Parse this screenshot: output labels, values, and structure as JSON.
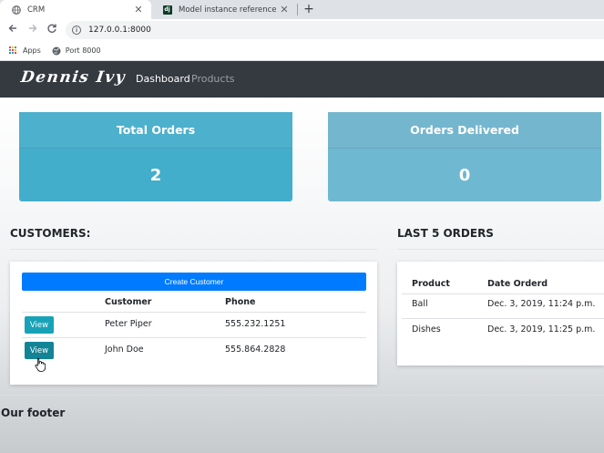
{
  "browser": {
    "tabs": [
      {
        "title": "CRM",
        "active": true
      },
      {
        "title": "Model instance reference | Djang",
        "active": false
      }
    ],
    "close_glyph": "✕",
    "new_tab_glyph": "+",
    "url": "127.0.0.1:8000",
    "bookmarks": [
      {
        "label": "Apps",
        "icon": "apps-grid-icon"
      },
      {
        "label": "Port 8000",
        "icon": "globe-icon"
      }
    ],
    "django_favicon_text": "dj"
  },
  "navbar": {
    "brand": "Dennis Ivy",
    "links": [
      {
        "label": "Dashboard",
        "active": true
      },
      {
        "label": "Products",
        "active": false
      }
    ]
  },
  "stats": {
    "total_orders": {
      "label": "Total Orders",
      "value": "2",
      "color": "#42aecb"
    },
    "orders_delivered": {
      "label": "Orders Delivered",
      "value": "0",
      "color": "#6fb8d1"
    }
  },
  "customers": {
    "title": "CUSTOMERS:",
    "create_label": "Create Customer",
    "columns": [
      "Customer",
      "Phone"
    ],
    "view_label": "View",
    "rows": [
      {
        "name": "Peter Piper",
        "phone": "555.232.1251"
      },
      {
        "name": "John Doe",
        "phone": "555.864.2828"
      }
    ]
  },
  "orders": {
    "title": "LAST 5 ORDERS",
    "columns": [
      "Product",
      "Date Orderd"
    ],
    "rows": [
      {
        "product": "Ball",
        "date": "Dec. 3, 2019, 11:24 p.m."
      },
      {
        "product": "Dishes",
        "date": "Dec. 3, 2019, 11:25 p.m."
      }
    ]
  },
  "footer": {
    "text": "Our footer"
  },
  "colors": {
    "navbar": "#343a40",
    "primary_button": "#007bff",
    "info_button": "#17a2b8"
  }
}
